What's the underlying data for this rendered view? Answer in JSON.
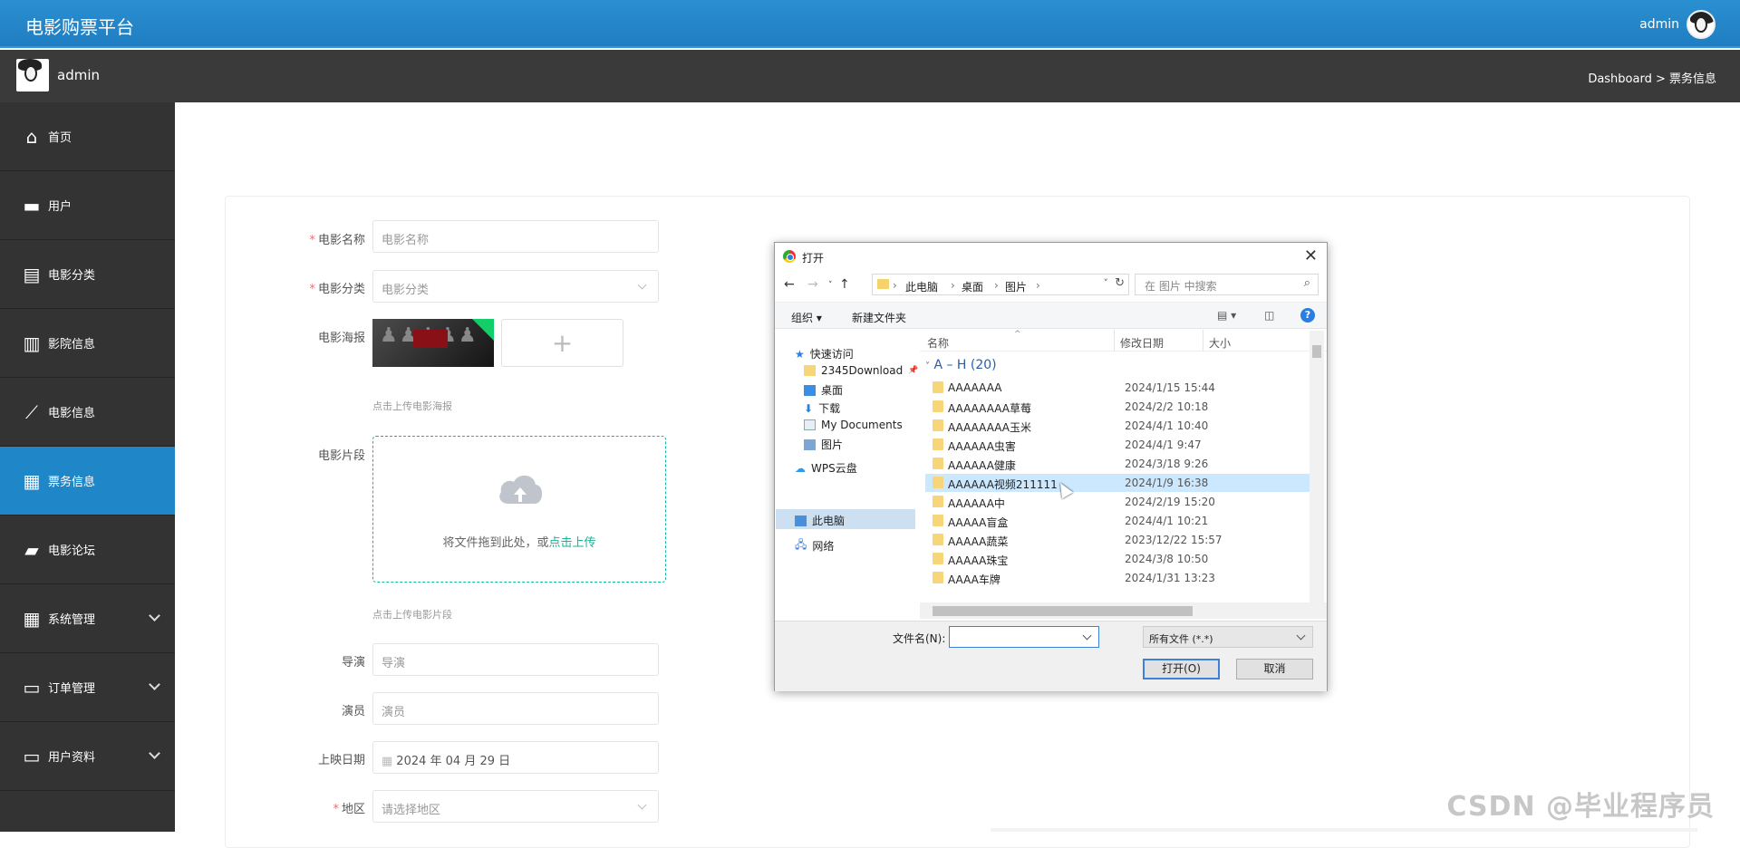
{
  "header": {
    "app_title": "电影购票平台",
    "username": "admin"
  },
  "subheader": {
    "username": "admin",
    "breadcrumb": "Dashboard > 票务信息"
  },
  "sidebar": {
    "items": [
      {
        "label": "首页",
        "icon": "home-icon"
      },
      {
        "label": "用户",
        "icon": "briefcase-icon"
      },
      {
        "label": "电影分类",
        "icon": "document-icon"
      },
      {
        "label": "影院信息",
        "icon": "book-icon"
      },
      {
        "label": "电影信息",
        "icon": "trend-chart-icon"
      },
      {
        "label": "票务信息",
        "icon": "grid-icon",
        "active": true
      },
      {
        "label": "电影论坛",
        "icon": "ticket-icon"
      },
      {
        "label": "系统管理",
        "icon": "grid-icon",
        "expandable": true
      },
      {
        "label": "订单管理",
        "icon": "monitor-icon",
        "expandable": true
      },
      {
        "label": "用户资料",
        "icon": "card-icon",
        "expandable": true
      }
    ]
  },
  "form": {
    "movie_name": {
      "label": "电影名称",
      "placeholder": "电影名称"
    },
    "movie_category": {
      "label": "电影分类",
      "placeholder": "电影分类"
    },
    "poster": {
      "label": "电影海报",
      "hint": "点击上传电影海报"
    },
    "clip": {
      "label": "电影片段",
      "drop_text": "将文件拖到此处，或",
      "drop_link": "点击上传",
      "hint": "点击上传电影片段"
    },
    "director": {
      "label": "导演",
      "placeholder": "导演"
    },
    "actor": {
      "label": "演员",
      "placeholder": "演员"
    },
    "release_date": {
      "label": "上映日期",
      "value": "2024 年 04 月 29 日"
    },
    "region": {
      "label": "地区",
      "placeholder": "请选择地区"
    }
  },
  "dialog": {
    "title": "打开",
    "path": [
      "此电脑",
      "桌面",
      "图片"
    ],
    "search_placeholder": "在 图片 中搜索",
    "toolbar": {
      "organize": "组织",
      "new_folder": "新建文件夹"
    },
    "columns": {
      "name": "名称",
      "modified": "修改日期",
      "size": "大小"
    },
    "nav": {
      "quick_access": "快速访问",
      "pinned": [
        "2345Download",
        "桌面",
        "下载",
        "My Documents",
        "图片"
      ],
      "wps": "WPS云盘",
      "this_pc": "此电脑",
      "network": "网络"
    },
    "group": "A – H (20)",
    "files": [
      {
        "name": "AAAAAAA",
        "date": "2024/1/15 15:44"
      },
      {
        "name": "AAAAAAAA草莓",
        "date": "2024/2/2 10:18"
      },
      {
        "name": "AAAAAAAA玉米",
        "date": "2024/4/1 10:40"
      },
      {
        "name": "AAAAAA虫害",
        "date": "2024/4/1 9:47"
      },
      {
        "name": "AAAAAA健康",
        "date": "2024/3/18 9:26"
      },
      {
        "name": "AAAAAA视频211111",
        "date": "2024/1/9 16:38",
        "selected": true
      },
      {
        "name": "AAAAAA中",
        "date": "2024/2/19 15:20"
      },
      {
        "name": "AAAAA盲盒",
        "date": "2024/4/1 10:21"
      },
      {
        "name": "AAAAA蔬菜",
        "date": "2023/12/22 15:57"
      },
      {
        "name": "AAAAA珠宝",
        "date": "2024/3/8 10:50"
      },
      {
        "name": "AAAA车牌",
        "date": "2024/1/31 13:23"
      }
    ],
    "filename_label": "文件名(N):",
    "filetype": "所有文件 (*.*)",
    "open_label": "打开(O)",
    "cancel_label": "取消"
  },
  "watermark": "CSDN @毕业程序员"
}
